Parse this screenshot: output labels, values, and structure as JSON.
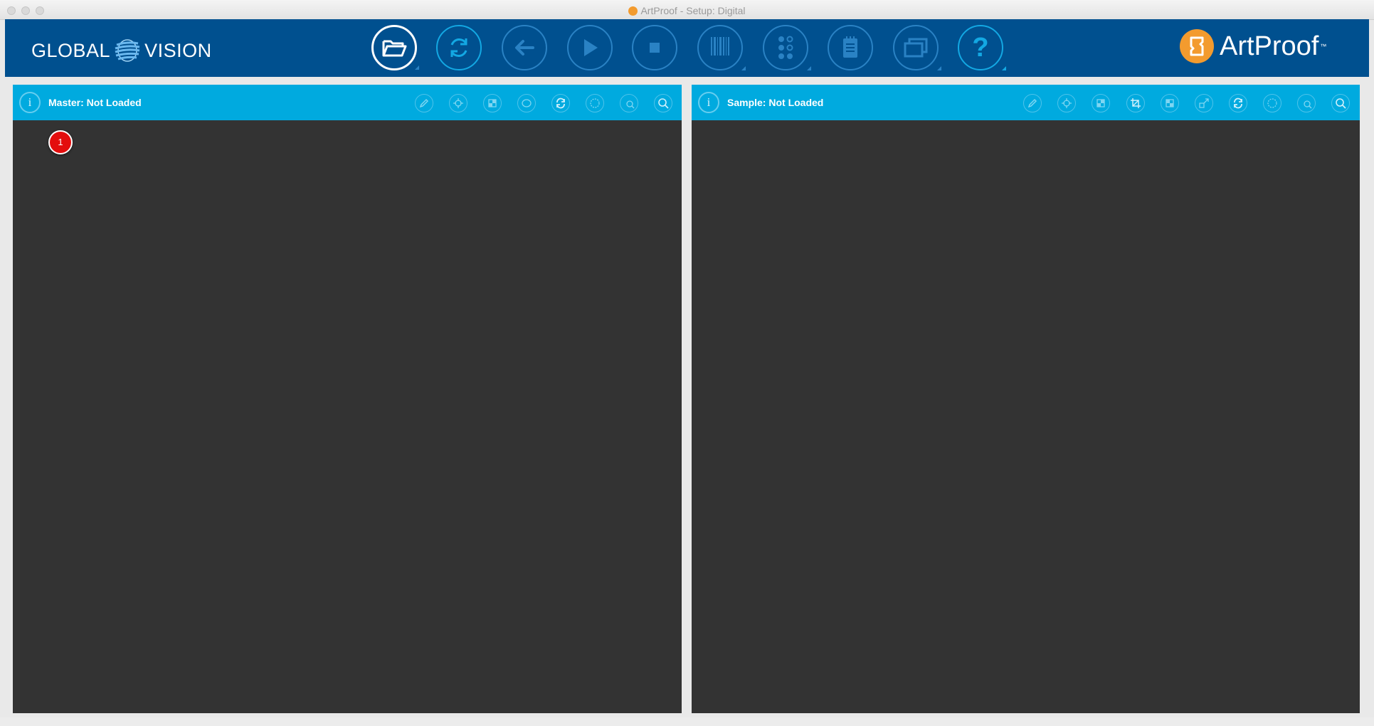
{
  "window": {
    "title": "ArtProof - Setup: Digital"
  },
  "brand": {
    "left_logo_a": "GLOBAL",
    "left_logo_b": "VISION",
    "right_logo": "ArtProof",
    "right_logo_tm": "™",
    "accent_orange": "#f39b2e"
  },
  "toolbar": {
    "buttons": [
      {
        "icon": "folder-open-icon",
        "active": true
      },
      {
        "icon": "refresh-icon"
      },
      {
        "icon": "back-arrow-icon"
      },
      {
        "icon": "play-icon"
      },
      {
        "icon": "stop-icon"
      },
      {
        "icon": "barcode-icon"
      },
      {
        "icon": "braille-icon"
      },
      {
        "icon": "notepad-icon"
      },
      {
        "icon": "windows-icon"
      },
      {
        "icon": "help-icon",
        "label": "?"
      }
    ]
  },
  "master": {
    "title": "Master: Not Loaded",
    "info_label": "i",
    "tools": [
      "pencil-icon",
      "crosshair-icon",
      "compare-icon",
      "selection-icon",
      "rotate-icon",
      "lasso-icon",
      "zoom-area-icon",
      "zoom-icon"
    ]
  },
  "sample": {
    "title": "Sample: Not Loaded",
    "info_label": "i",
    "tools": [
      "pencil-icon",
      "crosshair-icon",
      "compare-icon",
      "crop-icon",
      "grid-icon",
      "resize-icon",
      "rotate-icon",
      "lasso-icon",
      "zoom-area-icon",
      "zoom-icon"
    ]
  },
  "annotation": {
    "step": "1"
  },
  "colors": {
    "header_bg": "#00508f",
    "panel_bar": "#00aadf",
    "panel_bg": "#333333",
    "badge_red": "#e30d0d"
  }
}
